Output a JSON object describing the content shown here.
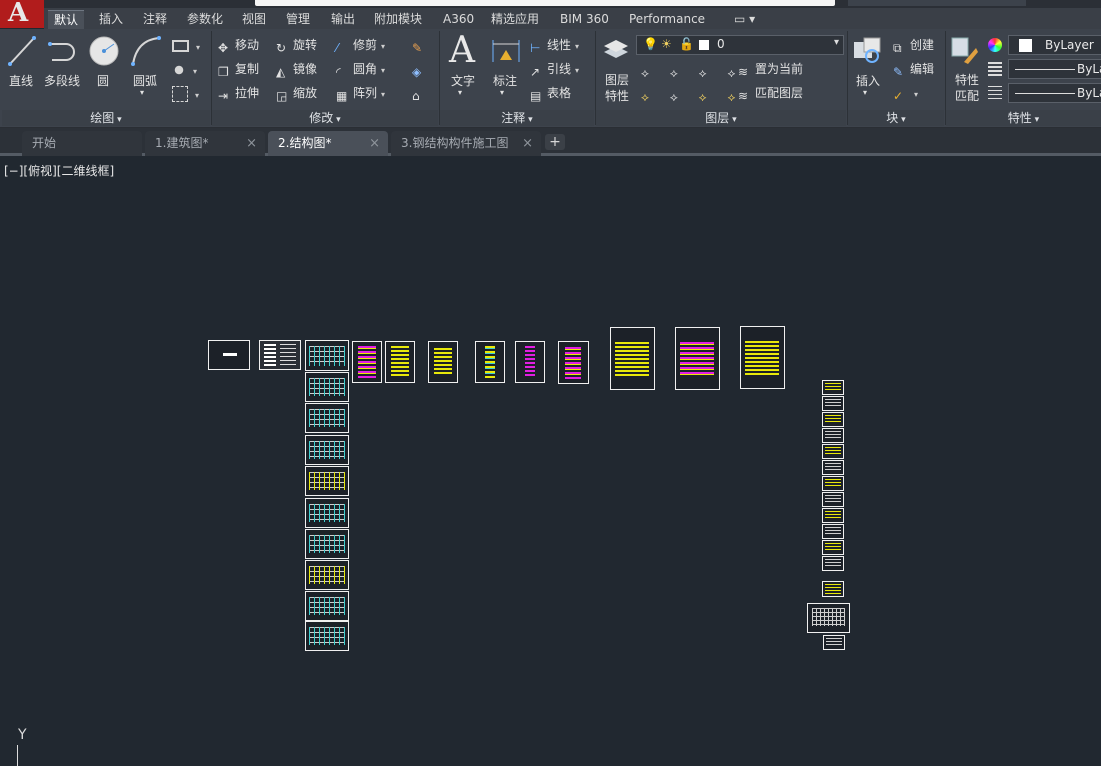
{
  "ribbon_tabs": [
    "默认",
    "插入",
    "注释",
    "参数化",
    "视图",
    "管理",
    "输出",
    "附加模块",
    "A360",
    "精选应用",
    "BIM 360",
    "Performance"
  ],
  "active_tab": "默认",
  "draw_panel": {
    "title": "绘图",
    "line": "直线",
    "polyline": "多段线",
    "circle": "圆",
    "arc": "圆弧"
  },
  "modify_panel": {
    "title": "修改",
    "move": "移动",
    "rotate": "旋转",
    "trim": "修剪",
    "copy": "复制",
    "mirror": "镜像",
    "fillet": "圆角",
    "stretch": "拉伸",
    "scale": "缩放",
    "array": "阵列"
  },
  "annotation_panel": {
    "title": "注释",
    "text": "文字",
    "dimension": "标注",
    "linear": "线性",
    "leader": "引线",
    "table": "表格"
  },
  "layers_panel": {
    "title": "图层",
    "layer_properties": "图层\n特性",
    "layer_value": "0",
    "set_current": "置为当前",
    "match_layer": "匹配图层"
  },
  "block_panel": {
    "title": "块",
    "insert": "插入",
    "create": "创建",
    "edit": "编辑"
  },
  "properties_panel": {
    "title": "特性",
    "match": "特性\n匹配",
    "color": "ByLayer",
    "linetype": "ByLa",
    "lineweight": "ByLa"
  },
  "file_tabs": [
    {
      "label": "开始",
      "active": false
    },
    {
      "label": "1.建筑图*",
      "active": false
    },
    {
      "label": "2.结构图*",
      "active": true
    },
    {
      "label": "3.钢结构构件施工图",
      "active": false
    }
  ],
  "viewport_label": "[−][俯视][二维线框]",
  "ucs_axis": "Y",
  "colors": {
    "background": "#212830",
    "ribbon": "#3d434c",
    "accent_red": "#b11c1c",
    "sheet_border": "#f0f0f0",
    "yellow": "#e8e80a",
    "magenta": "#e21ee2",
    "cyan": "#3fd0d0"
  }
}
